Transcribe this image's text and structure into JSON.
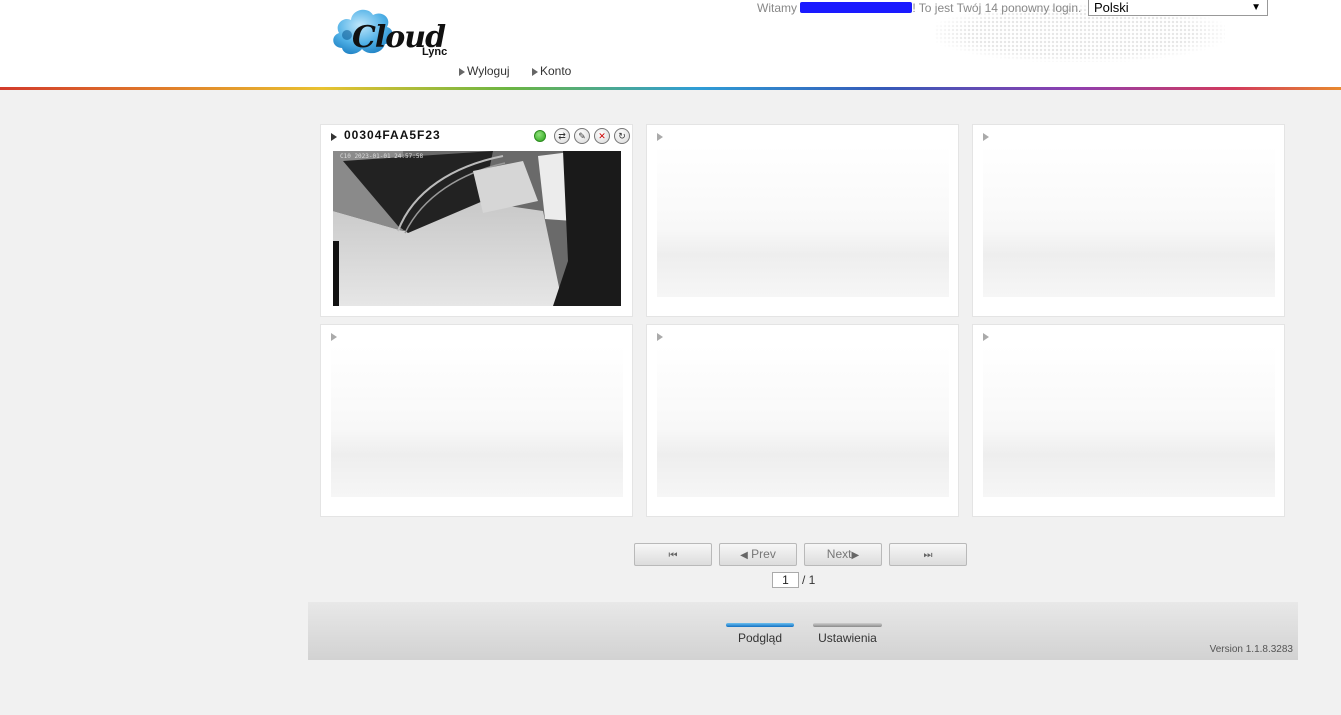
{
  "header": {
    "logo_word": "Cloud",
    "logo_sub": "Lync",
    "nav": {
      "logout": "Wyloguj",
      "account": "Konto"
    },
    "welcome_prefix": "Witamy",
    "welcome_suffix": "! To jest Twój 14 ponowny login.",
    "language": {
      "selected": "Polski"
    }
  },
  "grid": {
    "tiles": [
      {
        "camera_id": "00304FAA5F23",
        "status": "online",
        "feed_timestamp": "C10 2023-01-01 24:57:58",
        "icons": [
          "status-led-icon",
          "snapshot-icon",
          "settings-wrench-icon",
          "mute-icon",
          "refresh-icon"
        ]
      },
      {
        "camera_id": ""
      },
      {
        "camera_id": ""
      },
      {
        "camera_id": ""
      },
      {
        "camera_id": ""
      },
      {
        "camera_id": ""
      }
    ]
  },
  "pager": {
    "first_glyph": "⏮",
    "prev_glyph": "◀",
    "prev_label": "Prev",
    "next_label": "Next",
    "next_glyph": "▶",
    "last_glyph": "⏭",
    "current_page": "1",
    "total_pages": "/ 1"
  },
  "footer": {
    "tabs": [
      {
        "label": "Podgląd",
        "active": true
      },
      {
        "label": "Ustawienia",
        "active": false
      }
    ],
    "version": "Version 1.1.8.3283"
  },
  "colors": {
    "accent_blue": "#1370c2",
    "status_green": "#2aa61a",
    "background": "#f1f1f1"
  }
}
